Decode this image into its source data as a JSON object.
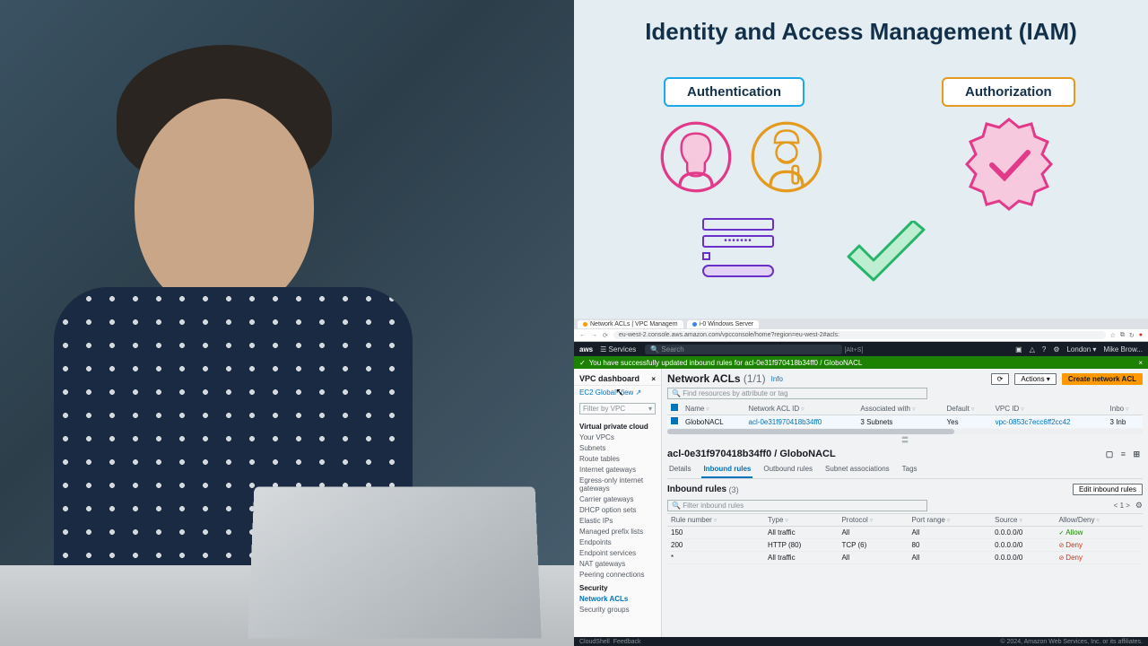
{
  "diagram": {
    "title": "Identity and Access Management (IAM)",
    "authn_label": "Authentication",
    "authz_label": "Authorization"
  },
  "browser": {
    "tab1": "Network ACLs | VPC Managem",
    "tab2": "i-0 Windows Server",
    "url": "eu-west-2.console.aws.amazon.com/vpcconsole/home?region=eu-west-2#acls:",
    "shortcut": "[Alt+S]"
  },
  "awsbar": {
    "logo": "aws",
    "services": "Services",
    "search_placeholder": "Search",
    "region": "London ▾",
    "user": "Mike Brow..."
  },
  "banner": "You have successfully updated inbound rules for acl-0e31f970418b34ff0 / GloboNACL",
  "sidebar": {
    "title": "VPC dashboard",
    "ec2": "EC2 Global View",
    "filter": "Filter by VPC",
    "cat1": "Virtual private cloud",
    "items1": [
      "Your VPCs",
      "Subnets",
      "Route tables",
      "Internet gateways",
      "Egress-only internet gateways",
      "Carrier gateways",
      "DHCP option sets",
      "Elastic IPs",
      "Managed prefix lists",
      "Endpoints",
      "Endpoint services",
      "NAT gateways",
      "Peering connections"
    ],
    "cat2": "Security",
    "items2": [
      "Network ACLs",
      "Security groups"
    ]
  },
  "page": {
    "title": "Network ACLs",
    "count": "(1/1)",
    "info": "Info",
    "refresh": "⟳",
    "actions": "Actions ▾",
    "create": "Create network ACL",
    "find_placeholder": "Find resources by attribute or tag"
  },
  "acltable": {
    "headers": [
      "Name",
      "Network ACL ID",
      "Associated with",
      "Default",
      "VPC ID",
      "Inbo"
    ],
    "row": {
      "name": "GloboNACL",
      "aclid": "acl-0e31f970418b34ff0",
      "assoc": "3 Subnets",
      "default": "Yes",
      "vpcid": "vpc-0853c7ecc6ff2cc42",
      "inbo": "3 Inb"
    }
  },
  "detail": {
    "title": "acl-0e31f970418b34ff0 / GloboNACL",
    "tabs": [
      "Details",
      "Inbound rules",
      "Outbound rules",
      "Subnet associations",
      "Tags"
    ]
  },
  "rules": {
    "title": "Inbound rules",
    "count": "(3)",
    "edit": "Edit inbound rules",
    "pager": "< 1 >",
    "filter_placeholder": "Filter inbound rules",
    "headers": [
      "Rule number",
      "Type",
      "Protocol",
      "Port range",
      "Source",
      "Allow/Deny"
    ]
  },
  "chart_data": {
    "type": "table",
    "title": "Inbound rules",
    "columns": [
      "Rule number",
      "Type",
      "Protocol",
      "Port range",
      "Source",
      "Allow/Deny"
    ],
    "rows": [
      {
        "rule": "150",
        "type": "All traffic",
        "protocol": "All",
        "port": "All",
        "source": "0.0.0.0/0",
        "action": "Allow"
      },
      {
        "rule": "200",
        "type": "HTTP (80)",
        "protocol": "TCP (6)",
        "port": "80",
        "source": "0.0.0.0/0",
        "action": "Deny"
      },
      {
        "rule": "*",
        "type": "All traffic",
        "protocol": "All",
        "port": "All",
        "source": "0.0.0.0/0",
        "action": "Deny"
      }
    ]
  },
  "footer": {
    "cloudshell": "CloudShell",
    "feedback": "Feedback",
    "copyright": "© 2024, Amazon Web Services, Inc. or its affiliates."
  }
}
